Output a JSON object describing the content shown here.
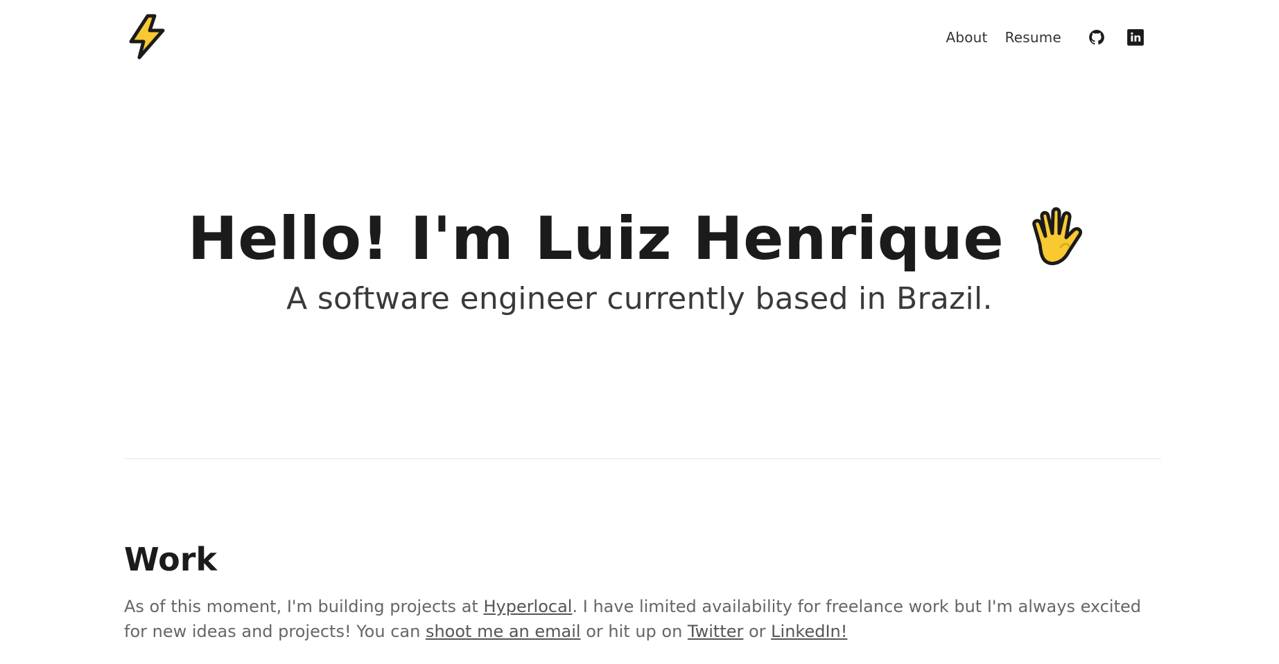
{
  "header": {
    "logo_icon": "lightning-bolt-icon",
    "nav": {
      "about": "About",
      "resume": "Resume",
      "github_icon": "github-icon",
      "linkedin_icon": "linkedin-icon"
    }
  },
  "hero": {
    "title": "Hello! I'm Luiz Henrique",
    "hand_icon": "waving-hand-icon",
    "subtitle": "A software engineer currently based in Brazil."
  },
  "work": {
    "heading": "Work",
    "text_1": "As of this moment, I'm building projects at ",
    "link_hyperlocal": "Hyperlocal",
    "text_2": ". I have limited availability for freelance work but I'm always excited for new ideas and projects! You can ",
    "link_email": "shoot me an email",
    "text_3": " or hit up on ",
    "link_twitter": "Twitter",
    "text_4": " or ",
    "link_linkedin": "LinkedIn!"
  },
  "colors": {
    "accent_yellow": "#F9C932",
    "text_dark": "#1b1b1b",
    "text_muted": "#666666"
  }
}
